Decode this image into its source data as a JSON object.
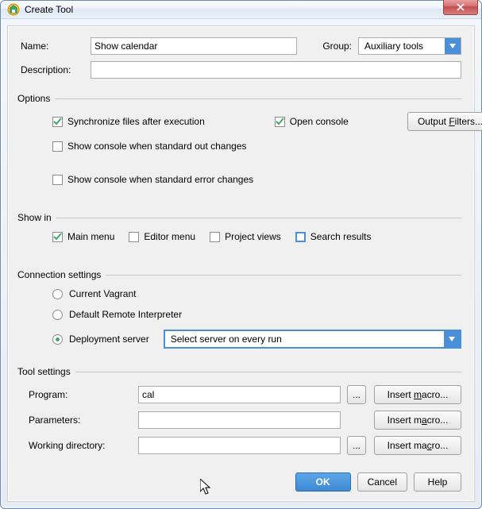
{
  "window": {
    "title": "Create Tool"
  },
  "fields": {
    "name_label": "Name:",
    "name_value": "Show calendar",
    "group_label": "Group:",
    "group_value": "Auxiliary tools",
    "description_label": "Description:",
    "description_value": ""
  },
  "options": {
    "legend": "Options",
    "sync": {
      "label": "Synchronize files after execution",
      "checked": true
    },
    "open_console": {
      "label": "Open console",
      "checked": true
    },
    "output_filters": "Output Filters...",
    "show_stdout": {
      "label": "Show console when standard out changes",
      "checked": false
    },
    "show_stderr": {
      "label": "Show console when standard error changes",
      "checked": false
    }
  },
  "show_in": {
    "legend": "Show in",
    "main_menu": {
      "label": "Main menu",
      "checked": true
    },
    "editor_menu": {
      "label": "Editor menu",
      "checked": false
    },
    "project_views": {
      "label": "Project views",
      "checked": false
    },
    "search_results": {
      "label": "Search results",
      "checked": false
    }
  },
  "connection": {
    "legend": "Connection settings",
    "current_vagrant": "Current Vagrant",
    "default_remote": "Default Remote Interpreter",
    "deployment_server": "Deployment server",
    "deployment_value": "Select server on every run",
    "selected": "deployment_server"
  },
  "tool": {
    "legend": "Tool settings",
    "program_label": "Program:",
    "program_value": "cal",
    "parameters_label": "Parameters:",
    "parameters_value": "",
    "workdir_label": "Working directory:",
    "workdir_value": "",
    "browse": "...",
    "insert_macro": "Insert macro..."
  },
  "buttons": {
    "ok": "OK",
    "cancel": "Cancel",
    "help": "Help"
  }
}
